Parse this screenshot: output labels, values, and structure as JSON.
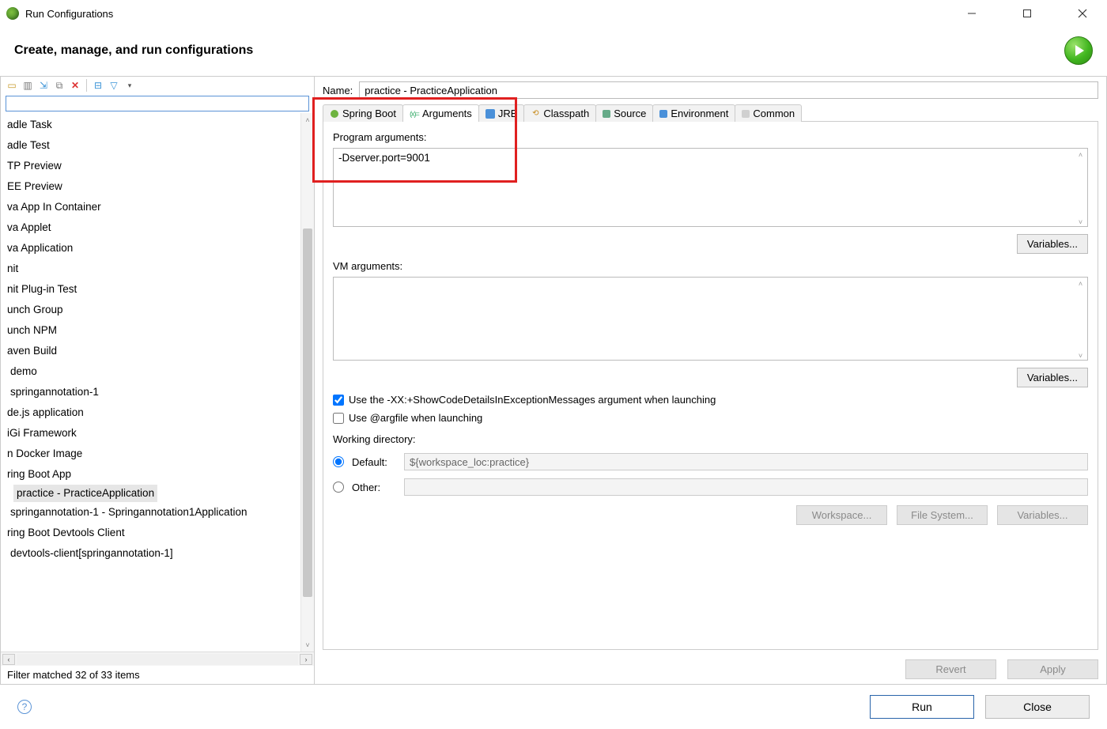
{
  "window": {
    "title": "Run Configurations"
  },
  "header": {
    "title": "Create, manage, and run configurations"
  },
  "left": {
    "filter_value": "",
    "items": [
      {
        "label": "adle Task"
      },
      {
        "label": "adle Test"
      },
      {
        "label": "TP Preview"
      },
      {
        "label": "EE Preview"
      },
      {
        "label": "va App In Container"
      },
      {
        "label": "va Applet"
      },
      {
        "label": "va Application"
      },
      {
        "label": "nit"
      },
      {
        "label": "nit Plug-in Test"
      },
      {
        "label": "unch Group"
      },
      {
        "label": "unch NPM"
      },
      {
        "label": "aven Build"
      },
      {
        "label": "demo",
        "indent": true
      },
      {
        "label": "springannotation-1",
        "indent": true
      },
      {
        "label": "de.js application"
      },
      {
        "label": "iGi Framework"
      },
      {
        "label": "n Docker Image"
      },
      {
        "label": "ring Boot App"
      },
      {
        "label": "practice - PracticeApplication",
        "indent": true,
        "selected": true
      },
      {
        "label": "springannotation-1 - Springannotation1Application",
        "indent": true
      },
      {
        "label": "ring Boot Devtools Client"
      },
      {
        "label": "devtools-client[springannotation-1]",
        "indent": true
      }
    ],
    "filter_status": "Filter matched 32 of 33 items"
  },
  "right": {
    "name_label": "Name:",
    "name_value": "practice - PracticeApplication",
    "tabs": [
      {
        "label": "Spring Boot",
        "icon": "springboot"
      },
      {
        "label": "Arguments",
        "icon": "args",
        "active": true
      },
      {
        "label": "JRE",
        "icon": "jre"
      },
      {
        "label": "Classpath",
        "icon": "classpath"
      },
      {
        "label": "Source",
        "icon": "source"
      },
      {
        "label": "Environment",
        "icon": "env"
      },
      {
        "label": "Common",
        "icon": "common"
      }
    ],
    "program_args_label": "Program arguments:",
    "program_args_value": "-Dserver.port=9001",
    "vm_args_label": "VM arguments:",
    "vm_args_value": "",
    "variables_btn": "Variables...",
    "check1_label": "Use the -XX:+ShowCodeDetailsInExceptionMessages argument when launching",
    "check1_checked": true,
    "check2_label": "Use @argfile when launching",
    "check2_checked": false,
    "workdir_label": "Working directory:",
    "wd_default_label": "Default:",
    "wd_default_value": "${workspace_loc:practice}",
    "wd_other_label": "Other:",
    "wd_other_value": "",
    "wd_buttons": {
      "workspace": "Workspace...",
      "filesystem": "File System...",
      "variables": "Variables..."
    },
    "revert_btn": "Revert",
    "apply_btn": "Apply"
  },
  "footer": {
    "run": "Run",
    "close": "Close"
  }
}
